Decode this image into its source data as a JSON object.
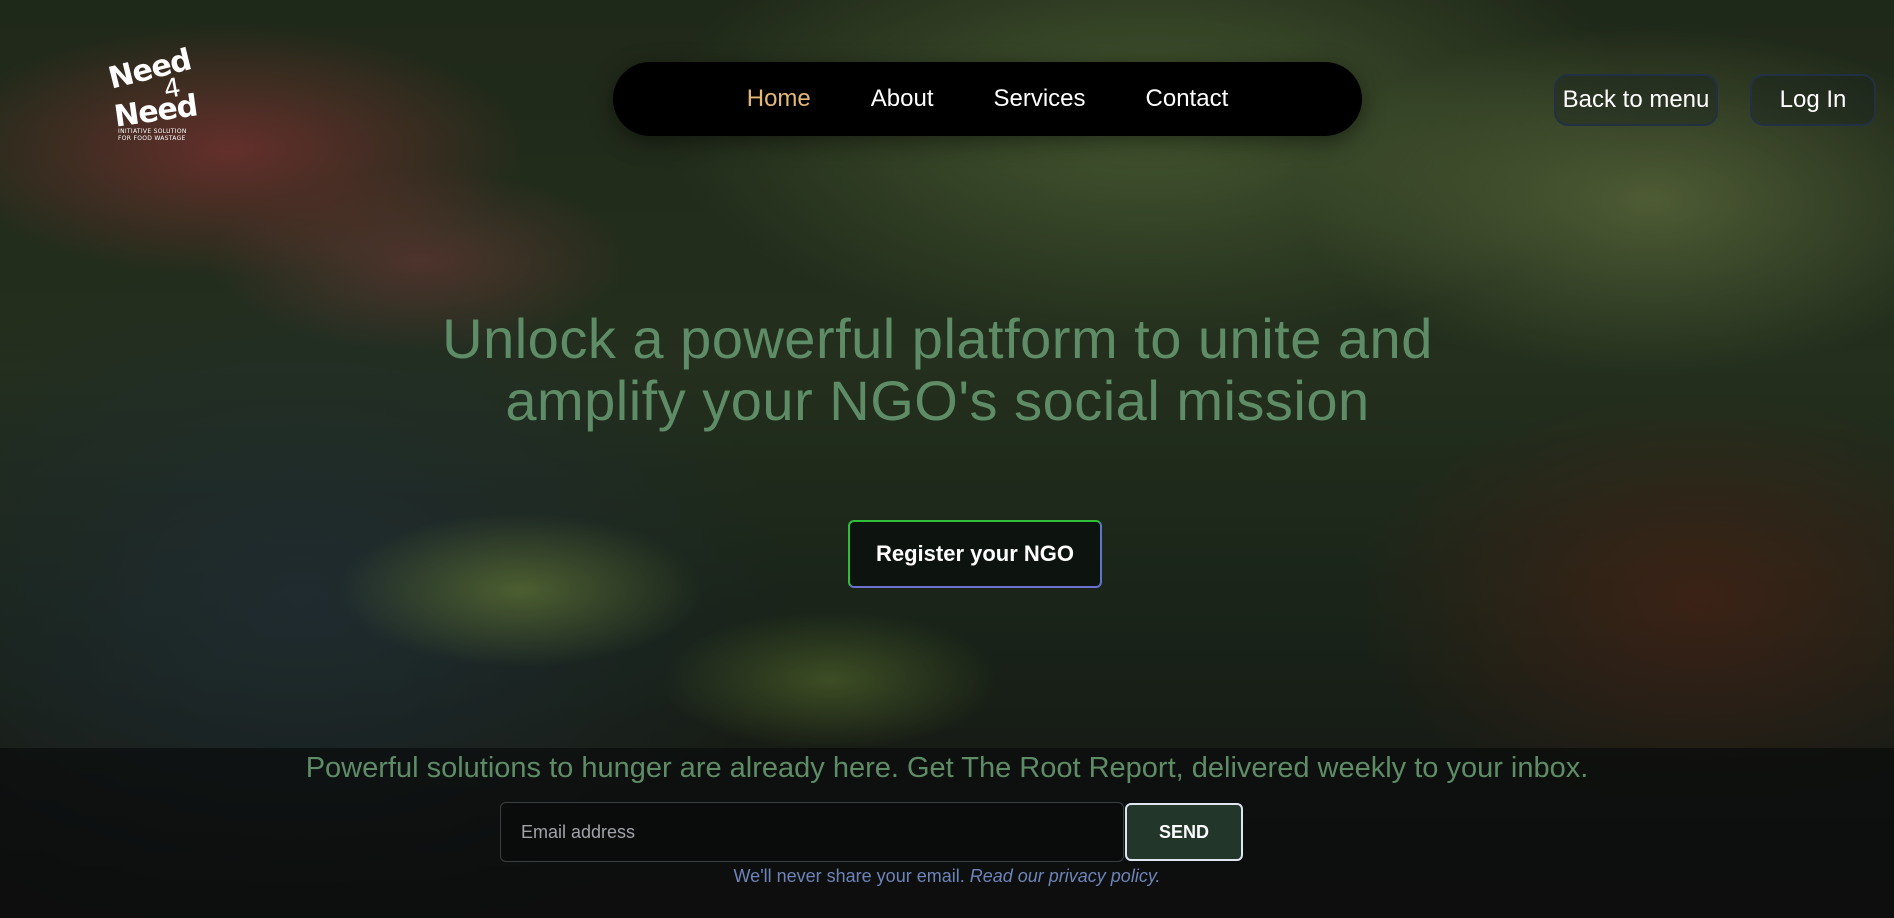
{
  "logo": {
    "line1": "Need",
    "line2": "4",
    "line3": "Need",
    "tagline1": "INITIATIVE SOLUTION",
    "tagline2": "FOR FOOD WASTAGE"
  },
  "nav": {
    "items": [
      {
        "label": "Home",
        "active": true
      },
      {
        "label": "About"
      },
      {
        "label": "Services"
      },
      {
        "label": "Contact"
      }
    ],
    "active_color": "#e3b877"
  },
  "header_buttons": {
    "back_label": "Back to menu",
    "login_label": "Log In"
  },
  "hero": {
    "line1": "Unlock a powerful platform to unite and",
    "line2": "amplify your NGO's social mission",
    "cta_label": "Register your NGO"
  },
  "newsletter": {
    "text": "Powerful solutions to hunger are already here. Get The Root Report, delivered weekly to your inbox.",
    "email_placeholder": "Email address",
    "email_value": "",
    "send_label": "SEND",
    "privacy_text": "We'll never share your email.",
    "privacy_link": "Read our privacy policy."
  },
  "colors": {
    "accent_green": "#5e8c66",
    "nav_bg": "#000000",
    "privacy_blue": "#6e84b8"
  }
}
